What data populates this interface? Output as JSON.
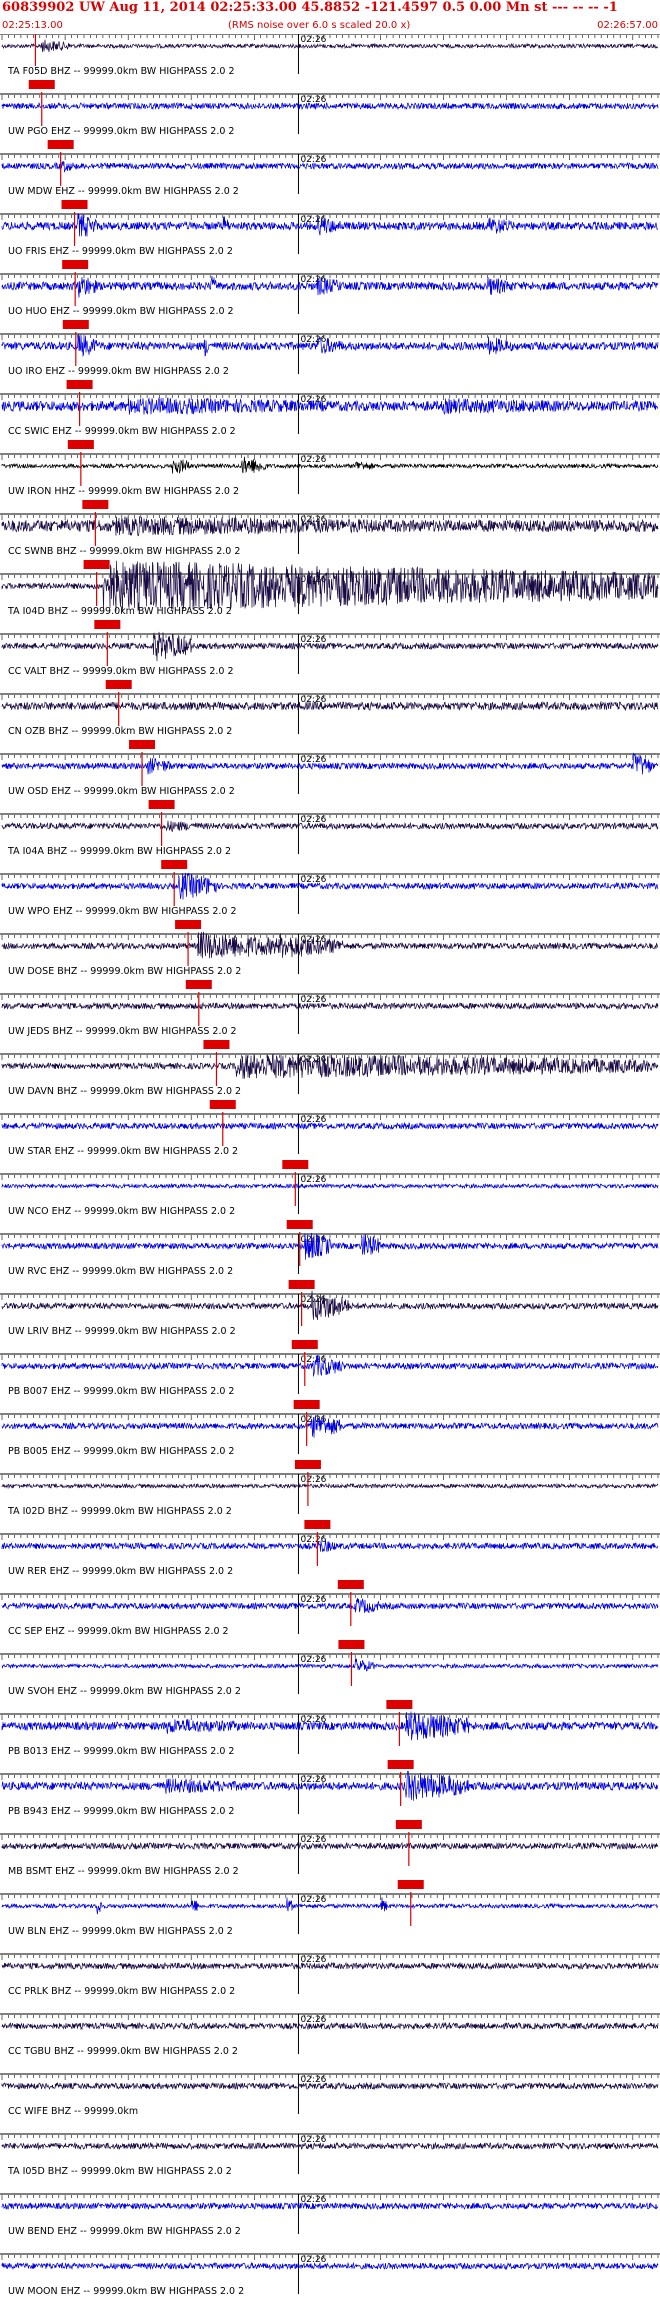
{
  "header": {
    "title": "60839902 UW Aug 11, 2014 02:25:33.00   45.8852 -121.4597  0.5 0.00 Mn st --- -- --  -1",
    "start_time": "02:25:13.00",
    "scale_note": "(RMS noise over 6.0 s scaled 20.0 x)",
    "end_time": "02:26:57.00"
  },
  "chart_data": {
    "type": "line",
    "title": "60839902 UW Aug 11, 2014 02:25:33.00   45.8852 -121.4597  0.5 0.00 Mn st --- -- --  -1",
    "x_range_seconds": [
      0,
      104
    ],
    "minute_tick_label": "02:26",
    "minute_tick_seconds": 47,
    "colors": {
      "blue": "#0000dd",
      "dark": "#1a0a44",
      "black": "#000000",
      "pick": "#dd0000"
    },
    "traces": [
      {
        "label": "TA F05D BHZ -- 99999.0km BW  HIGHPASS  2.0  2",
        "color": "dark",
        "amp": 2,
        "pick": 5.3,
        "events": [
          {
            "t": 6,
            "a": 7,
            "d": 5
          }
        ]
      },
      {
        "label": "UW PGO EHZ -- 99999.0km BW  HIGHPASS  2.0  2",
        "color": "blue",
        "amp": 3,
        "pick": 6.3,
        "events": []
      },
      {
        "label": "UW MDW EHZ -- 99999.0km BW  HIGHPASS  2.0  2",
        "color": "blue",
        "amp": 3,
        "pick": 9.3,
        "events": [
          {
            "t": 9.5,
            "a": 7,
            "d": 2
          }
        ]
      },
      {
        "label": "UO FRIS EHZ -- 99999.0km BW  HIGHPASS  2.0  2",
        "color": "blue",
        "amp": 4,
        "pick": 11.5,
        "events": [
          {
            "t": 12,
            "a": 14,
            "d": 3
          },
          {
            "t": 35,
            "a": 12,
            "d": 1
          },
          {
            "t": 50,
            "a": 10,
            "d": 4
          },
          {
            "t": 77,
            "a": 10,
            "d": 4
          }
        ]
      },
      {
        "label": "UO HUO EHZ -- 99999.0km BW  HIGHPASS  2.0  2",
        "color": "blue",
        "amp": 4,
        "pick": 11.6,
        "events": [
          {
            "t": 12,
            "a": 13,
            "d": 3
          },
          {
            "t": 33,
            "a": 12,
            "d": 1
          },
          {
            "t": 50,
            "a": 10,
            "d": 4
          },
          {
            "t": 77,
            "a": 10,
            "d": 4
          }
        ]
      },
      {
        "label": "UO IRO EHZ -- 99999.0km BW  HIGHPASS  2.0  2",
        "color": "blue",
        "amp": 4,
        "pick": 11.7,
        "events": [
          {
            "t": 12,
            "a": 13,
            "d": 3
          },
          {
            "t": 32,
            "a": 12,
            "d": 1
          },
          {
            "t": 50,
            "a": 10,
            "d": 4
          },
          {
            "t": 77,
            "a": 10,
            "d": 4
          }
        ]
      },
      {
        "label": "CC SWIC EHZ -- 99999.0km BW  HIGHPASS  2.0  2",
        "color": "blue",
        "amp": 5,
        "pick": 12.3,
        "events": [
          {
            "t": 20,
            "a": 9,
            "d": 40
          },
          {
            "t": 70,
            "a": 8,
            "d": 30
          }
        ]
      },
      {
        "label": "UW IRON HHZ -- 99999.0km BW  HIGHPASS  2.0  2",
        "color": "black",
        "amp": 2,
        "pick": 12.5,
        "events": [
          {
            "t": 27,
            "a": 9,
            "d": 3
          },
          {
            "t": 38,
            "a": 10,
            "d": 4
          },
          {
            "t": 56,
            "a": 6,
            "d": 3
          }
        ]
      },
      {
        "label": "CC SWNB BHZ -- 99999.0km BW  HIGHPASS  2.0  2",
        "color": "dark",
        "amp": 6,
        "pick": 14.8,
        "events": [
          {
            "t": 18,
            "a": 10,
            "d": 60
          }
        ]
      },
      {
        "label": "TA I04D BHZ -- 99999.0km BW  HIGHPASS  2.0  2",
        "color": "dark",
        "amp": 3,
        "pick": 15.0,
        "events": [
          {
            "t": 16,
            "a": 26,
            "d": 90
          }
        ]
      },
      {
        "label": "CC VALT BHZ -- 99999.0km BW  HIGHPASS  2.0  2",
        "color": "dark",
        "amp": 3,
        "pick": 16.7,
        "events": [
          {
            "t": 24,
            "a": 16,
            "d": 6
          }
        ]
      },
      {
        "label": "CN OZB BHZ -- 99999.0km BW  HIGHPASS  2.0  2",
        "color": "dark",
        "amp": 4,
        "pick": 18.5,
        "events": []
      },
      {
        "label": "UW OSD EHZ -- 99999.0km BW  HIGHPASS  2.0  2",
        "color": "blue",
        "amp": 3,
        "pick": 22.2,
        "events": [
          {
            "t": 23,
            "a": 9,
            "d": 4
          },
          {
            "t": 100,
            "a": 14,
            "d": 3
          }
        ]
      },
      {
        "label": "TA I04A BHZ -- 99999.0km BW  HIGHPASS  2.0  2",
        "color": "dark",
        "amp": 3,
        "pick": 25.3,
        "events": [
          {
            "t": 26,
            "a": 6,
            "d": 6
          }
        ]
      },
      {
        "label": "UW WPO EHZ -- 99999.0km BW  HIGHPASS  2.0  2",
        "color": "blue",
        "amp": 3,
        "pick": 27.3,
        "events": [
          {
            "t": 28,
            "a": 15,
            "d": 6
          }
        ]
      },
      {
        "label": "UW DOSE BHZ -- 99999.0km BW  HIGHPASS  2.0  2",
        "color": "dark",
        "amp": 3,
        "pick": 29.5,
        "events": [
          {
            "t": 31,
            "a": 15,
            "d": 14
          },
          {
            "t": 44,
            "a": 13,
            "d": 10
          }
        ]
      },
      {
        "label": "UW JEDS BHZ -- 99999.0km BW  HIGHPASS  2.0  2",
        "color": "dark",
        "amp": 3,
        "pick": 31.2,
        "events": []
      },
      {
        "label": "UW DAVN BHZ -- 99999.0km BW  HIGHPASS  2.0  2",
        "color": "dark",
        "amp": 3,
        "pick": 34.0,
        "events": [
          {
            "t": 37,
            "a": 13,
            "d": 66
          }
        ]
      },
      {
        "label": "UW STAR EHZ -- 99999.0km BW  HIGHPASS  2.0  2",
        "color": "blue",
        "amp": 3,
        "pick": 35.0,
        "events": []
      },
      {
        "label": "UW NCO EHZ -- 99999.0km BW  HIGHPASS  2.0  2",
        "color": "blue",
        "amp": 2,
        "pick": 46.5,
        "events": []
      },
      {
        "label": "UW RVC EHZ -- 99999.0km BW  HIGHPASS  2.0  2",
        "color": "blue",
        "amp": 3,
        "pick": 47.2,
        "events": [
          {
            "t": 48,
            "a": 16,
            "d": 4
          },
          {
            "t": 57,
            "a": 14,
            "d": 3
          }
        ]
      },
      {
        "label": "UW LRIV BHZ -- 99999.0km BW  HIGHPASS  2.0  2",
        "color": "dark",
        "amp": 3,
        "pick": 47.5,
        "events": [
          {
            "t": 49,
            "a": 16,
            "d": 6
          }
        ]
      },
      {
        "label": "PB B007 EHZ -- 99999.0km BW  HIGHPASS  2.0  2",
        "color": "blue",
        "amp": 3,
        "pick": 48.0,
        "events": [
          {
            "t": 49,
            "a": 12,
            "d": 5
          }
        ]
      },
      {
        "label": "PB B005 EHZ -- 99999.0km BW  HIGHPASS  2.0  2",
        "color": "blue",
        "amp": 3,
        "pick": 48.3,
        "events": [
          {
            "t": 49,
            "a": 13,
            "d": 5
          }
        ]
      },
      {
        "label": "TA I02D BHZ -- 99999.0km BW  HIGHPASS  2.0  2",
        "color": "dark",
        "amp": 2,
        "pick": 48.5,
        "events": []
      },
      {
        "label": "UW RER EHZ -- 99999.0km BW  HIGHPASS  2.0  2",
        "color": "blue",
        "amp": 3,
        "pick": 50.0,
        "events": [
          {
            "t": 50,
            "a": 8,
            "d": 3
          }
        ]
      },
      {
        "label": "CC SEP EHZ -- 99999.0km BW  HIGHPASS  2.0  2",
        "color": "blue",
        "amp": 3,
        "pick": 55.3,
        "events": [
          {
            "t": 56,
            "a": 9,
            "d": 4
          }
        ]
      },
      {
        "label": "UW SVOH EHZ -- 99999.0km BW  HIGHPASS  2.0  2",
        "color": "blue",
        "amp": 2,
        "pick": 55.4,
        "events": [
          {
            "t": 56,
            "a": 8,
            "d": 3
          }
        ]
      },
      {
        "label": "PB B013 EHZ -- 99999.0km BW  HIGHPASS  2.0  2",
        "color": "blue",
        "amp": 4,
        "pick": 63.0,
        "events": [
          {
            "t": 26,
            "a": 8,
            "d": 14
          },
          {
            "t": 64,
            "a": 16,
            "d": 10
          }
        ]
      },
      {
        "label": "PB B943 EHZ -- 99999.0km BW  HIGHPASS  2.0  2",
        "color": "blue",
        "amp": 4,
        "pick": 63.2,
        "events": [
          {
            "t": 26,
            "a": 8,
            "d": 14
          },
          {
            "t": 64,
            "a": 16,
            "d": 10
          }
        ]
      },
      {
        "label": "MB BSMT EHZ -- 99999.0km BW  HIGHPASS  2.0  2",
        "color": "dark",
        "amp": 3,
        "pick": 64.5,
        "events": []
      },
      {
        "label": "UW BLN EHZ -- 99999.0km BW  HIGHPASS  2.0  2",
        "color": "blue",
        "amp": 2,
        "pick": 64.8,
        "events": [
          {
            "t": 15,
            "a": 10,
            "d": 1
          },
          {
            "t": 30,
            "a": 10,
            "d": 1
          },
          {
            "t": 45,
            "a": 10,
            "d": 1
          },
          {
            "t": 60,
            "a": 10,
            "d": 1
          }
        ]
      },
      {
        "label": "CC PRLK BHZ -- 99999.0km BW  HIGHPASS  2.0  2",
        "color": "dark",
        "amp": 3,
        "pick": null,
        "events": []
      },
      {
        "label": "CC TGBU BHZ -- 99999.0km BW  HIGHPASS  2.0  2",
        "color": "dark",
        "amp": 3,
        "pick": null,
        "events": []
      },
      {
        "label": "CC WIFE BHZ -- 99999.0km",
        "color": "dark",
        "amp": 3,
        "pick": null,
        "events": []
      },
      {
        "label": "TA I05D BHZ -- 99999.0km BW  HIGHPASS  2.0  2",
        "color": "dark",
        "amp": 3,
        "pick": null,
        "events": []
      },
      {
        "label": "UW BEND EHZ -- 99999.0km BW  HIGHPASS  2.0  2",
        "color": "blue",
        "amp": 3,
        "pick": null,
        "events": []
      },
      {
        "label": "UW MOON EHZ -- 99999.0km BW  HIGHPASS  2.0  2",
        "color": "blue",
        "amp": 3,
        "pick": null,
        "events": []
      }
    ]
  }
}
